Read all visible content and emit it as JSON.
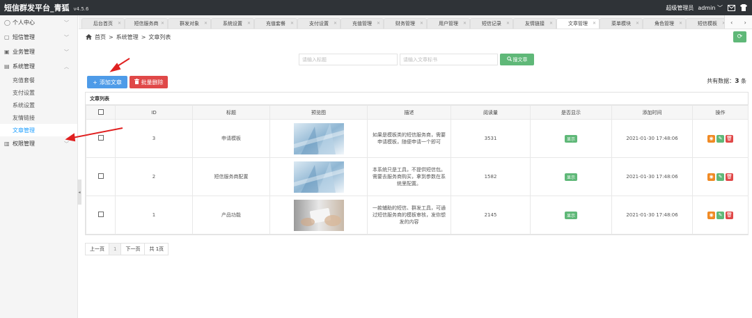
{
  "app": {
    "title": "短信群发平台_青狐",
    "version": "v4.5.6"
  },
  "topbar": {
    "user_role": "超级管理员",
    "user_name": "admin"
  },
  "sidebar": {
    "menus": [
      {
        "label": "个人中心",
        "icon": "user-icon"
      },
      {
        "label": "短信管理",
        "icon": "message-icon"
      },
      {
        "label": "业务管理",
        "icon": "business-icon"
      },
      {
        "label": "系统管理",
        "icon": "system-icon"
      }
    ],
    "submenu": [
      "充值套餐",
      "支付设置",
      "系统设置",
      "友情链接",
      "文章管理"
    ],
    "last_menu": {
      "label": "权限管理",
      "icon": "permission-icon"
    }
  },
  "tabs": [
    "后台首页",
    "短信服务商",
    "群发对象",
    "系统设置",
    "充值套餐",
    "支付设置",
    "充值管理",
    "财务管理",
    "用户管理",
    "短信记录",
    "友情链接",
    "文章管理",
    "菜单模块",
    "角色管理",
    "短信模板"
  ],
  "active_tab": "文章管理",
  "breadcrumb": {
    "home": "首页",
    "sep": ">",
    "level1": "系统管理",
    "level2": "文章列表"
  },
  "search": {
    "title_placeholder": "请输入标题",
    "tag_placeholder": "请输入文章标书",
    "button": "搜文章"
  },
  "actions": {
    "add": "添加文章",
    "batch_delete": "批量删除",
    "total_label": "共有数据：",
    "total_count": "3",
    "total_unit": "条"
  },
  "table": {
    "caption": "文章列表",
    "headers": [
      "ID",
      "标题",
      "预览图",
      "描述",
      "阅读量",
      "是否显示",
      "添加时间",
      "操作"
    ],
    "rows": [
      {
        "id": "3",
        "title": "申请模板",
        "desc": "如果是模板类的短信服务商，需要申请模板，随便申请一个即可",
        "views": "3531",
        "show": "显示",
        "time": "2021-01-30 17:48:06"
      },
      {
        "id": "2",
        "title": "短信服务商配置",
        "desc": "本系统只是工具，不提供短信包。需要去服务商购买，拿到参数在系统里配置。",
        "views": "1582",
        "show": "显示",
        "time": "2021-01-30 17:48:06"
      },
      {
        "id": "1",
        "title": "产品功能",
        "desc": "一款辅助的短信、群发工具，可通过短信服务商的模板审核，发你想发的内容",
        "views": "2145",
        "show": "显示",
        "time": "2021-01-30 17:48:06"
      }
    ]
  },
  "pager": {
    "prev": "上一页",
    "page": "1",
    "next": "下一页",
    "total": "共 1页"
  },
  "colors": {
    "topbar": "#2f3337",
    "primary": "#4e9be8",
    "success": "#5fb878",
    "danger": "#e04848",
    "warning": "#f08a24",
    "active_link": "#1e9fff"
  }
}
